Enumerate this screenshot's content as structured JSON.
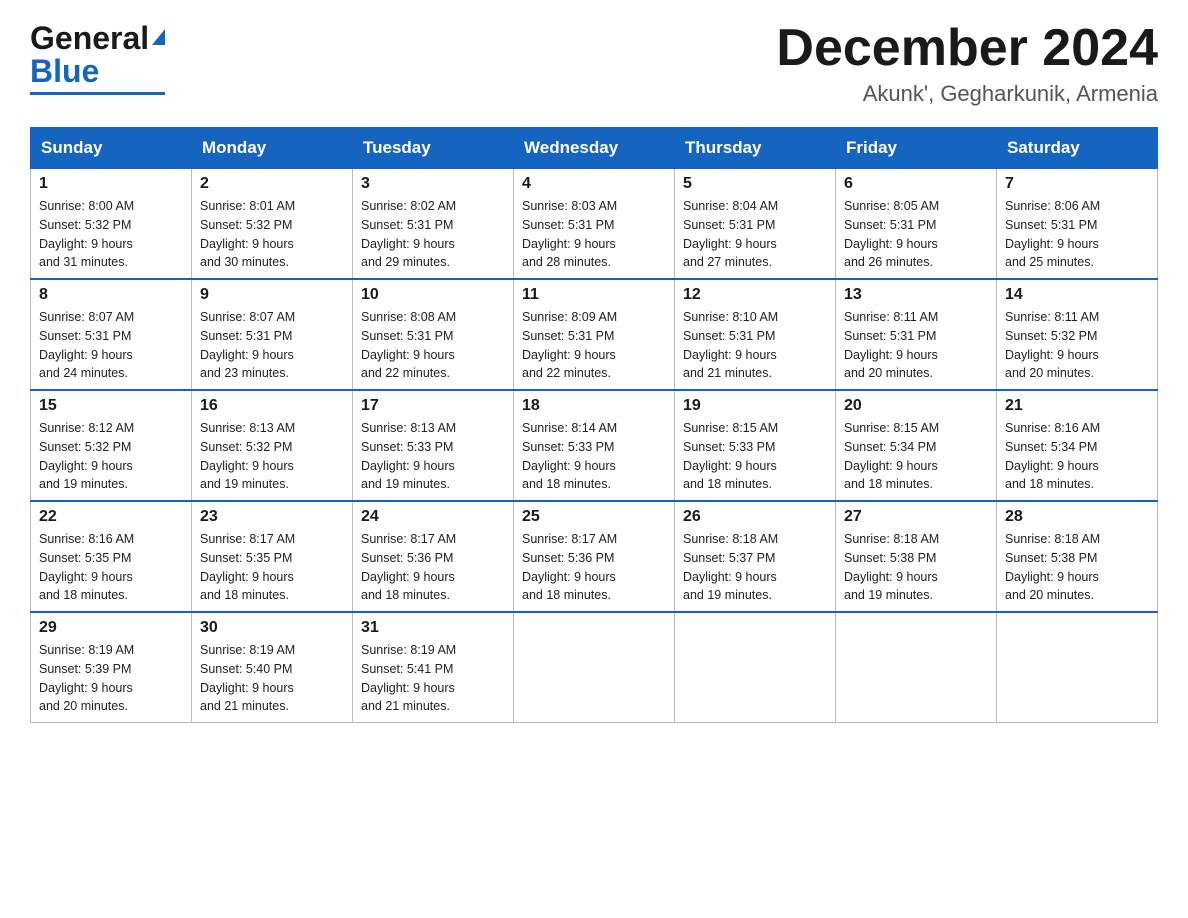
{
  "header": {
    "logo_general": "General",
    "logo_blue": "Blue",
    "month_title": "December 2024",
    "location": "Akunk', Gegharkunik, Armenia"
  },
  "days_of_week": [
    "Sunday",
    "Monday",
    "Tuesday",
    "Wednesday",
    "Thursday",
    "Friday",
    "Saturday"
  ],
  "weeks": [
    [
      {
        "day": "1",
        "sunrise": "8:00 AM",
        "sunset": "5:32 PM",
        "daylight": "9 hours and 31 minutes."
      },
      {
        "day": "2",
        "sunrise": "8:01 AM",
        "sunset": "5:32 PM",
        "daylight": "9 hours and 30 minutes."
      },
      {
        "day": "3",
        "sunrise": "8:02 AM",
        "sunset": "5:31 PM",
        "daylight": "9 hours and 29 minutes."
      },
      {
        "day": "4",
        "sunrise": "8:03 AM",
        "sunset": "5:31 PM",
        "daylight": "9 hours and 28 minutes."
      },
      {
        "day": "5",
        "sunrise": "8:04 AM",
        "sunset": "5:31 PM",
        "daylight": "9 hours and 27 minutes."
      },
      {
        "day": "6",
        "sunrise": "8:05 AM",
        "sunset": "5:31 PM",
        "daylight": "9 hours and 26 minutes."
      },
      {
        "day": "7",
        "sunrise": "8:06 AM",
        "sunset": "5:31 PM",
        "daylight": "9 hours and 25 minutes."
      }
    ],
    [
      {
        "day": "8",
        "sunrise": "8:07 AM",
        "sunset": "5:31 PM",
        "daylight": "9 hours and 24 minutes."
      },
      {
        "day": "9",
        "sunrise": "8:07 AM",
        "sunset": "5:31 PM",
        "daylight": "9 hours and 23 minutes."
      },
      {
        "day": "10",
        "sunrise": "8:08 AM",
        "sunset": "5:31 PM",
        "daylight": "9 hours and 22 minutes."
      },
      {
        "day": "11",
        "sunrise": "8:09 AM",
        "sunset": "5:31 PM",
        "daylight": "9 hours and 22 minutes."
      },
      {
        "day": "12",
        "sunrise": "8:10 AM",
        "sunset": "5:31 PM",
        "daylight": "9 hours and 21 minutes."
      },
      {
        "day": "13",
        "sunrise": "8:11 AM",
        "sunset": "5:31 PM",
        "daylight": "9 hours and 20 minutes."
      },
      {
        "day": "14",
        "sunrise": "8:11 AM",
        "sunset": "5:32 PM",
        "daylight": "9 hours and 20 minutes."
      }
    ],
    [
      {
        "day": "15",
        "sunrise": "8:12 AM",
        "sunset": "5:32 PM",
        "daylight": "9 hours and 19 minutes."
      },
      {
        "day": "16",
        "sunrise": "8:13 AM",
        "sunset": "5:32 PM",
        "daylight": "9 hours and 19 minutes."
      },
      {
        "day": "17",
        "sunrise": "8:13 AM",
        "sunset": "5:33 PM",
        "daylight": "9 hours and 19 minutes."
      },
      {
        "day": "18",
        "sunrise": "8:14 AM",
        "sunset": "5:33 PM",
        "daylight": "9 hours and 18 minutes."
      },
      {
        "day": "19",
        "sunrise": "8:15 AM",
        "sunset": "5:33 PM",
        "daylight": "9 hours and 18 minutes."
      },
      {
        "day": "20",
        "sunrise": "8:15 AM",
        "sunset": "5:34 PM",
        "daylight": "9 hours and 18 minutes."
      },
      {
        "day": "21",
        "sunrise": "8:16 AM",
        "sunset": "5:34 PM",
        "daylight": "9 hours and 18 minutes."
      }
    ],
    [
      {
        "day": "22",
        "sunrise": "8:16 AM",
        "sunset": "5:35 PM",
        "daylight": "9 hours and 18 minutes."
      },
      {
        "day": "23",
        "sunrise": "8:17 AM",
        "sunset": "5:35 PM",
        "daylight": "9 hours and 18 minutes."
      },
      {
        "day": "24",
        "sunrise": "8:17 AM",
        "sunset": "5:36 PM",
        "daylight": "9 hours and 18 minutes."
      },
      {
        "day": "25",
        "sunrise": "8:17 AM",
        "sunset": "5:36 PM",
        "daylight": "9 hours and 18 minutes."
      },
      {
        "day": "26",
        "sunrise": "8:18 AM",
        "sunset": "5:37 PM",
        "daylight": "9 hours and 19 minutes."
      },
      {
        "day": "27",
        "sunrise": "8:18 AM",
        "sunset": "5:38 PM",
        "daylight": "9 hours and 19 minutes."
      },
      {
        "day": "28",
        "sunrise": "8:18 AM",
        "sunset": "5:38 PM",
        "daylight": "9 hours and 20 minutes."
      }
    ],
    [
      {
        "day": "29",
        "sunrise": "8:19 AM",
        "sunset": "5:39 PM",
        "daylight": "9 hours and 20 minutes."
      },
      {
        "day": "30",
        "sunrise": "8:19 AM",
        "sunset": "5:40 PM",
        "daylight": "9 hours and 21 minutes."
      },
      {
        "day": "31",
        "sunrise": "8:19 AM",
        "sunset": "5:41 PM",
        "daylight": "9 hours and 21 minutes."
      },
      null,
      null,
      null,
      null
    ]
  ],
  "labels": {
    "sunrise": "Sunrise:",
    "sunset": "Sunset:",
    "daylight": "Daylight:"
  }
}
